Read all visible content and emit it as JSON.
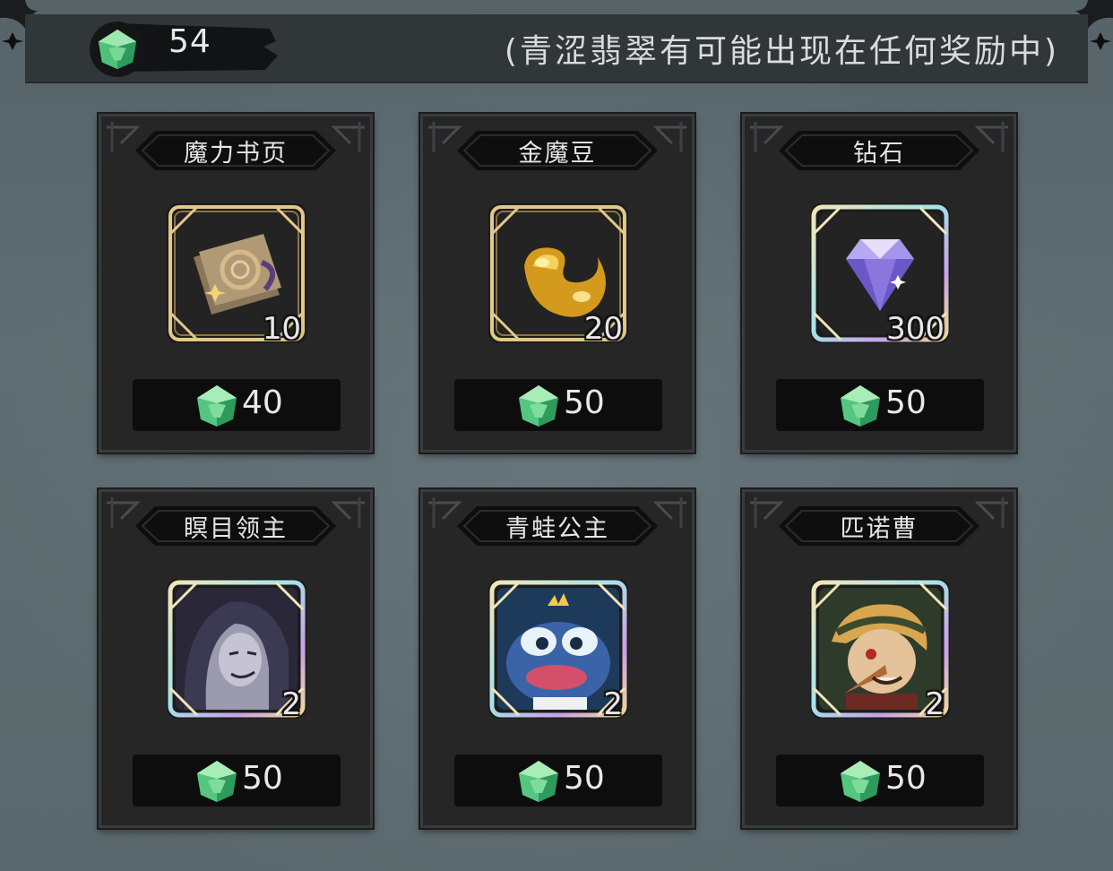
{
  "currency": {
    "name_icon": "green-emerald-icon",
    "amount": "54"
  },
  "notice": "(青涩翡翠有可能出现在任何奖励中)",
  "items": [
    {
      "name": "魔力书页",
      "quantity": "10",
      "price": "40",
      "art": "magic-pages-icon",
      "frame": "gold"
    },
    {
      "name": "金魔豆",
      "quantity": "20",
      "price": "50",
      "art": "golden-bean-icon",
      "frame": "gold"
    },
    {
      "name": "钻石",
      "quantity": "300",
      "price": "50",
      "art": "diamond-icon",
      "frame": "rainbow"
    },
    {
      "name": "瞑目领主",
      "quantity": "2",
      "price": "50",
      "art": "hooded-lord-portrait",
      "frame": "rainbow"
    },
    {
      "name": "青蛙公主",
      "quantity": "2",
      "price": "50",
      "art": "frog-princess-portrait",
      "frame": "rainbow"
    },
    {
      "name": "匹诺曹",
      "quantity": "2",
      "price": "50",
      "art": "pinocchio-portrait",
      "frame": "rainbow"
    }
  ],
  "colors": {
    "card_bg": "#262627",
    "price_bg": "#0d0d0e",
    "gold": "#e2c98a",
    "emerald": "#4fc27a"
  }
}
